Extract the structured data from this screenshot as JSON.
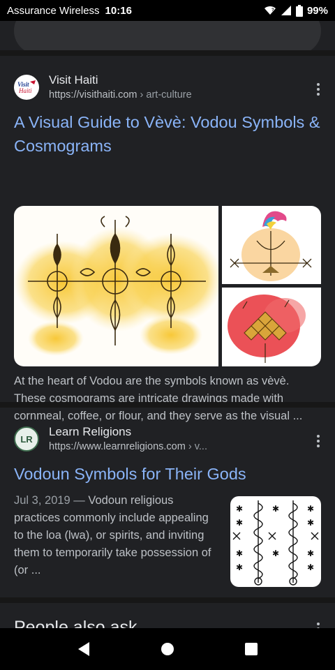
{
  "status_bar": {
    "carrier": "Assurance Wireless",
    "time": "10:16",
    "battery": "99%",
    "icons": [
      "wifi-icon",
      "signal-icon",
      "battery-icon"
    ]
  },
  "results": [
    {
      "site_name": "Visit Haiti",
      "url": "https://visithaiti.com",
      "breadcrumb": "› art-culture",
      "favicon_text": "Visit Haiti",
      "title": "A Visual Guide to Vèvè: Vodou Symbols & Cosmograms",
      "snippet": "At the heart of Vodou are the symbols known as vèvè. These cosmograms are intricate drawings made with cornmeal, coffee, or flour, and they serve as the visual ..."
    },
    {
      "site_name": "Learn Religions",
      "url": "https://www.learnreligions.com",
      "breadcrumb": "› v...",
      "favicon_text": "LR",
      "title": "Vodoun Symbols for Their Gods",
      "date": "Jul 3, 2019 —",
      "snippet": "Vodoun religious practices commonly include appealing to the loa (lwa), or spirits, and inviting them to temporarily take possession of (or ..."
    }
  ],
  "people_also_ask": "People also ask",
  "colors": {
    "background": "#202124",
    "link": "#8ab4f8",
    "text": "#e8eaed",
    "secondary": "#bdc1c6"
  }
}
